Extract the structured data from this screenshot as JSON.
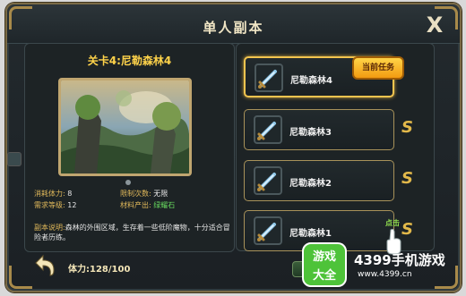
{
  "header": {
    "title": "单人副本",
    "close_label": "X"
  },
  "stage": {
    "title": "关卡4:尼勒森林4",
    "stats": {
      "stamina_cost_label": "消耗体力:",
      "stamina_cost_value": "8",
      "attempt_limit_label": "限制次数:",
      "attempt_limit_value": "无限",
      "required_level_label": "需求等级:",
      "required_level_value": "12",
      "material_output_label": "材料产出:",
      "material_output_value": "绿耀石"
    },
    "description_label": "副本说明:",
    "description_text": "森林的外围区域，生存着一些低阶魔物，十分适合冒险者历练。"
  },
  "footer": {
    "stamina_text": "体力:128/100"
  },
  "levels": [
    {
      "name": "尼勒森林4",
      "badge": "当前任务"
    },
    {
      "name": "尼勒森林3",
      "badge": ""
    },
    {
      "name": "尼勒森林2",
      "badge": ""
    },
    {
      "name": "尼勒森林1",
      "badge": ""
    }
  ],
  "rating_mark": "S",
  "click_hint": "点击",
  "watermark": {
    "logo_line1": "游戏",
    "logo_line2": "大全",
    "brand": "4399手机游戏",
    "site": "www.4399.cn"
  },
  "colors": {
    "gold": "#ffd34a",
    "green": "#66d65e",
    "badge": "#f29b11"
  }
}
